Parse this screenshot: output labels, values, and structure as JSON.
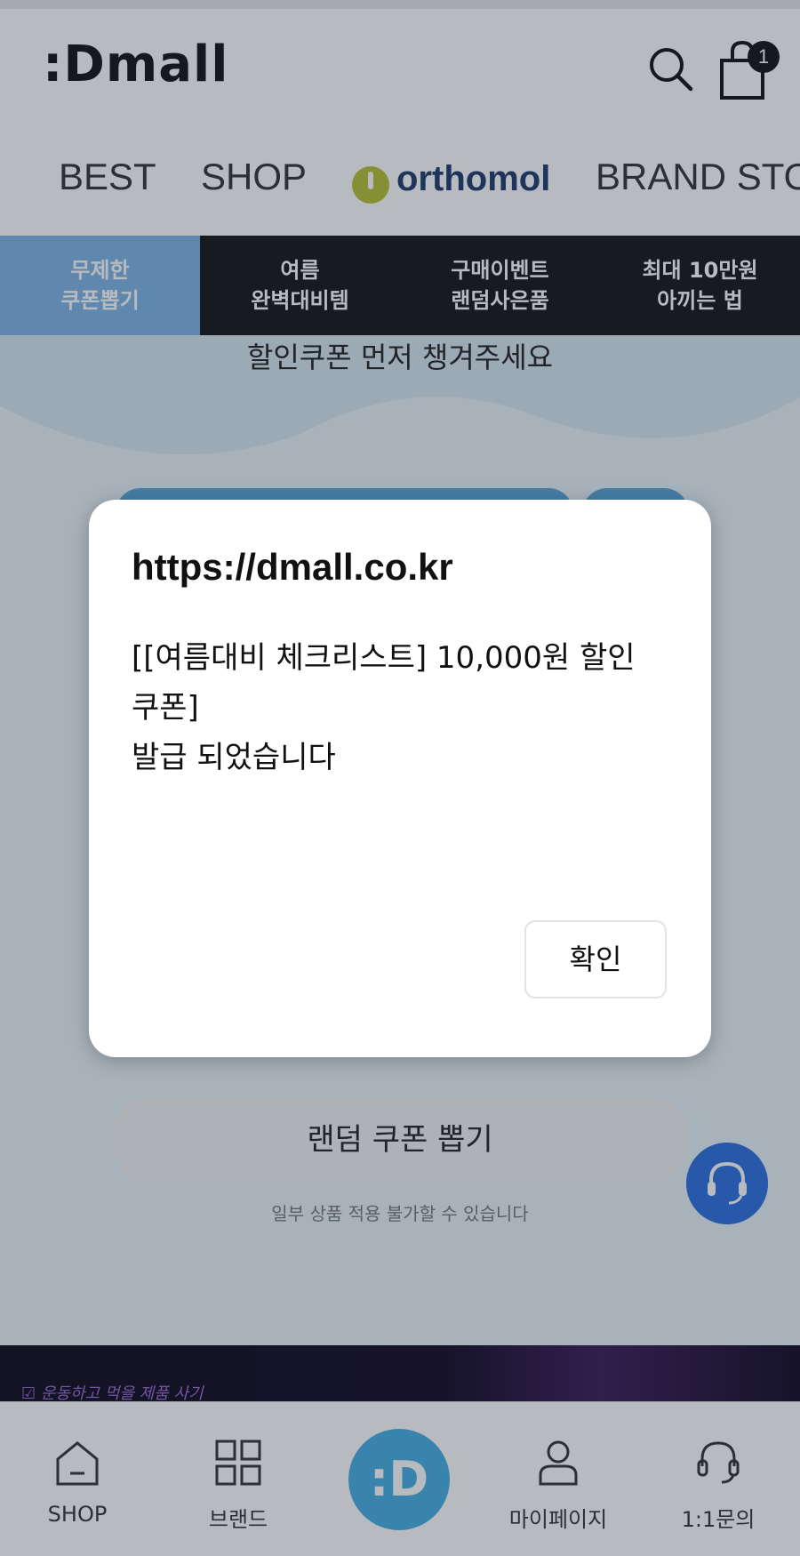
{
  "header": {
    "logo_text": ":Dmall",
    "cart_count": "1"
  },
  "nav": {
    "tabs": [
      {
        "label": "BEST"
      },
      {
        "label": "SHOP"
      },
      {
        "label": "orthomol"
      },
      {
        "label": "BRAND STO"
      }
    ]
  },
  "events": {
    "items": [
      {
        "line1": "무제한",
        "line2": "쿠폰뽑기",
        "active": true
      },
      {
        "line1": "여름",
        "line2": "완벽대비템",
        "active": false
      },
      {
        "line1": "구매이벤트",
        "line2": "랜덤사은품",
        "active": false
      },
      {
        "line1": "최대 10만원",
        "line2": "아끼는 법",
        "active": false
      }
    ]
  },
  "main": {
    "headline": "할인쿠폰 먼저 챙겨주세요",
    "random_button": "랜덤 쿠폰 뽑기",
    "note": "일부 상품 적용 불가할 수 있습니다"
  },
  "promo": {
    "text": "☑ 운동하고 먹을 제품 사기"
  },
  "bottom_nav": {
    "items": [
      {
        "label": "SHOP",
        "icon": "home-icon"
      },
      {
        "label": "브랜드",
        "icon": "grid-icon"
      },
      {
        "label": ":D",
        "icon": "dmall-logo-icon"
      },
      {
        "label": "마이페이지",
        "icon": "person-icon"
      },
      {
        "label": "1:1문의",
        "icon": "headset-icon"
      }
    ]
  },
  "dialog": {
    "title": "https://dmall.co.kr",
    "message": "[[여름대비 체크리스트] 10,000원 할인\n쿠폰]\n발급 되었습니다",
    "ok_label": "확인"
  },
  "colors": {
    "accent_blue": "#46b0e6",
    "event_active": "#7fb4e6",
    "fab_blue": "#2d6fe0",
    "brand_green": "#b5c234",
    "brand_navy": "#1e3a6e"
  }
}
